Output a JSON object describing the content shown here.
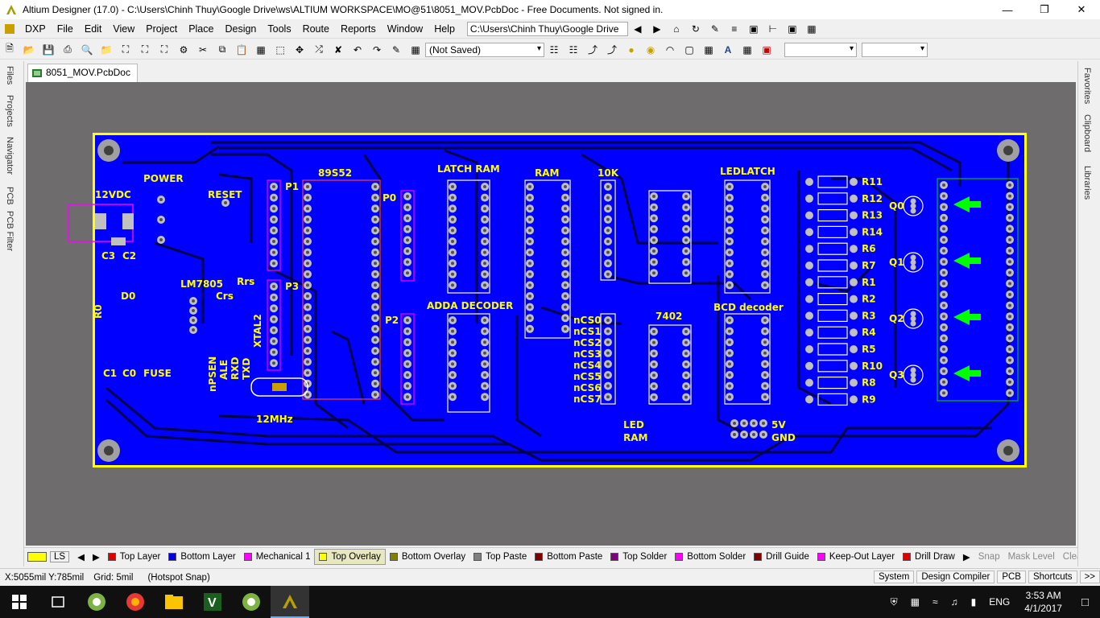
{
  "window": {
    "title": "Altium Designer (17.0) - C:\\Users\\Chinh Thuy\\Google Drive\\ws\\ALTIUM WORKSPACE\\MO@51\\8051_MOV.PcbDoc - Free Documents. Not signed in."
  },
  "menu": {
    "items": [
      "DXP",
      "File",
      "Edit",
      "View",
      "Project",
      "Place",
      "Design",
      "Tools",
      "Route",
      "Reports",
      "Window",
      "Help"
    ],
    "path_combo": "C:\\Users\\Chinh Thuy\\Google Drive"
  },
  "toolbar": {
    "saved_state": "(Not Saved)"
  },
  "left_panels": [
    "Files",
    "Projects",
    "Navigator",
    "PCB",
    "PCB Filter"
  ],
  "right_panels": [
    "Favorites",
    "Clipboard",
    "Libraries"
  ],
  "document_tab": "8051_MOV.PcbDoc",
  "pcb": {
    "labels": {
      "power": "POWER",
      "vdc": "12VDC",
      "reset": "RESET",
      "ic": "89S52",
      "p1": "P1",
      "p0": "P0",
      "p3": "P3",
      "p2": "P2",
      "latch_ram": "LATCH RAM",
      "ram": "RAM",
      "tenk": "10K",
      "ledlatch": "LEDLATCH",
      "adda": "ADDA DECODER",
      "ic7402": "7402",
      "bcd": "BCD decoder",
      "lm7805": "LM7805",
      "rrs": "Rrs",
      "crs": "Crs",
      "xtal": "XTAL2",
      "mhz": "12MHz",
      "c3": "C3",
      "c2": "C2",
      "d0": "D0",
      "r0": "R0",
      "c1": "C1",
      "c0": "C0",
      "fuse": "FUSE",
      "led": "LED",
      "ramlbl": "RAM",
      "v5": "5V",
      "gnd": "GND",
      "ctrl": [
        "nPSEN",
        "ALE",
        "RXD",
        "TXD"
      ],
      "ncs": [
        "nCS0",
        "nCS1",
        "nCS2",
        "nCS3",
        "nCS4",
        "nCS5",
        "nCS6",
        "nCS7"
      ],
      "resistors": [
        "R11",
        "R12",
        "R13",
        "R14",
        "R6",
        "R7",
        "R1",
        "R2",
        "R3",
        "R4",
        "R5",
        "R10",
        "R8",
        "R9"
      ],
      "transistors": [
        "Q0",
        "Q1",
        "Q2",
        "Q3"
      ]
    }
  },
  "layers": {
    "current_set": "LS",
    "items": [
      {
        "name": "Top Layer",
        "color": "#e00000"
      },
      {
        "name": "Bottom Layer",
        "color": "#0000e0"
      },
      {
        "name": "Mechanical 1",
        "color": "#ff00ff"
      },
      {
        "name": "Top Overlay",
        "color": "#ffff00"
      },
      {
        "name": "Bottom Overlay",
        "color": "#808000"
      },
      {
        "name": "Top Paste",
        "color": "#808080"
      },
      {
        "name": "Bottom Paste",
        "color": "#800000"
      },
      {
        "name": "Top Solder",
        "color": "#800080"
      },
      {
        "name": "Bottom Solder",
        "color": "#ff00ff"
      },
      {
        "name": "Drill Guide",
        "color": "#800000"
      },
      {
        "name": "Keep-Out Layer",
        "color": "#ff00ff"
      },
      {
        "name": "Drill Draw",
        "color": "#e00000"
      }
    ],
    "snap": "Snap",
    "mask_level": "Mask Level",
    "clear": "Clear"
  },
  "status": {
    "coords": "X:5055mil Y:785mil",
    "grid": "Grid: 5mil",
    "snap_mode": "(Hotspot Snap)",
    "buttons": [
      "System",
      "Design Compiler",
      "PCB",
      "Shortcuts"
    ]
  },
  "taskbar": {
    "lang": "ENG",
    "time": "3:53 AM",
    "date": "4/1/2017"
  }
}
